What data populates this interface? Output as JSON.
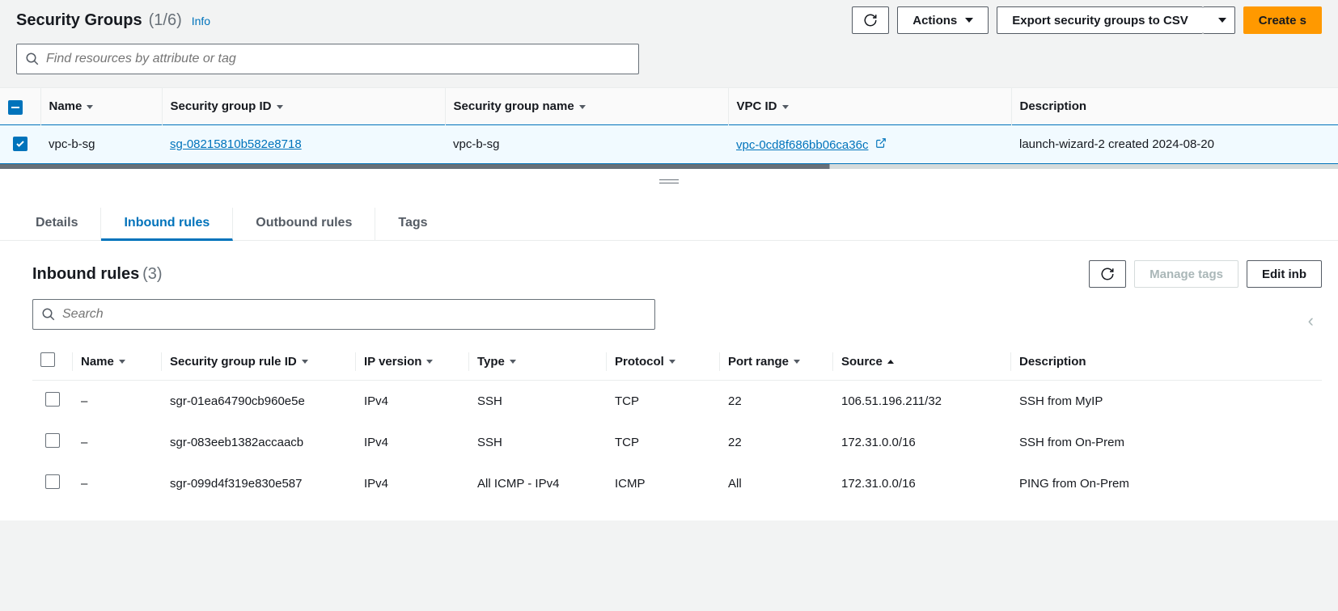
{
  "header": {
    "title": "Security Groups",
    "count": "(1/6)",
    "info": "Info"
  },
  "actions": {
    "actions_label": "Actions",
    "export_label": "Export security groups to CSV",
    "create_label": "Create s"
  },
  "search": {
    "placeholder": "Find resources by attribute or tag"
  },
  "sg_table": {
    "headers": {
      "name": "Name",
      "sgid": "Security group ID",
      "sgname": "Security group name",
      "vpcid": "VPC ID",
      "desc": "Description"
    },
    "row": {
      "name": "vpc-b-sg",
      "sgid": "sg-08215810b582e8718",
      "sgname": "vpc-b-sg",
      "vpcid": "vpc-0cd8f686bb06ca36c",
      "desc": "launch-wizard-2 created 2024-08-20"
    }
  },
  "tabs": {
    "details": "Details",
    "inbound": "Inbound rules",
    "outbound": "Outbound rules",
    "tags": "Tags"
  },
  "inbound": {
    "title": "Inbound rules",
    "count": "(3)",
    "manage_tags": "Manage tags",
    "edit": "Edit inb",
    "search_placeholder": "Search",
    "headers": {
      "name": "Name",
      "ruleid": "Security group rule ID",
      "ipver": "IP version",
      "type": "Type",
      "protocol": "Protocol",
      "port": "Port range",
      "source": "Source",
      "desc": "Description"
    },
    "rows": [
      {
        "name": "–",
        "ruleid": "sgr-01ea64790cb960e5e",
        "ipver": "IPv4",
        "type": "SSH",
        "protocol": "TCP",
        "port": "22",
        "source": "106.51.196.211/32",
        "desc": "SSH from MyIP"
      },
      {
        "name": "–",
        "ruleid": "sgr-083eeb1382accaacb",
        "ipver": "IPv4",
        "type": "SSH",
        "protocol": "TCP",
        "port": "22",
        "source": "172.31.0.0/16",
        "desc": "SSH from On-Prem"
      },
      {
        "name": "–",
        "ruleid": "sgr-099d4f319e830e587",
        "ipver": "IPv4",
        "type": "All ICMP - IPv4",
        "protocol": "ICMP",
        "port": "All",
        "source": "172.31.0.0/16",
        "desc": "PING from On-Prem"
      }
    ]
  }
}
